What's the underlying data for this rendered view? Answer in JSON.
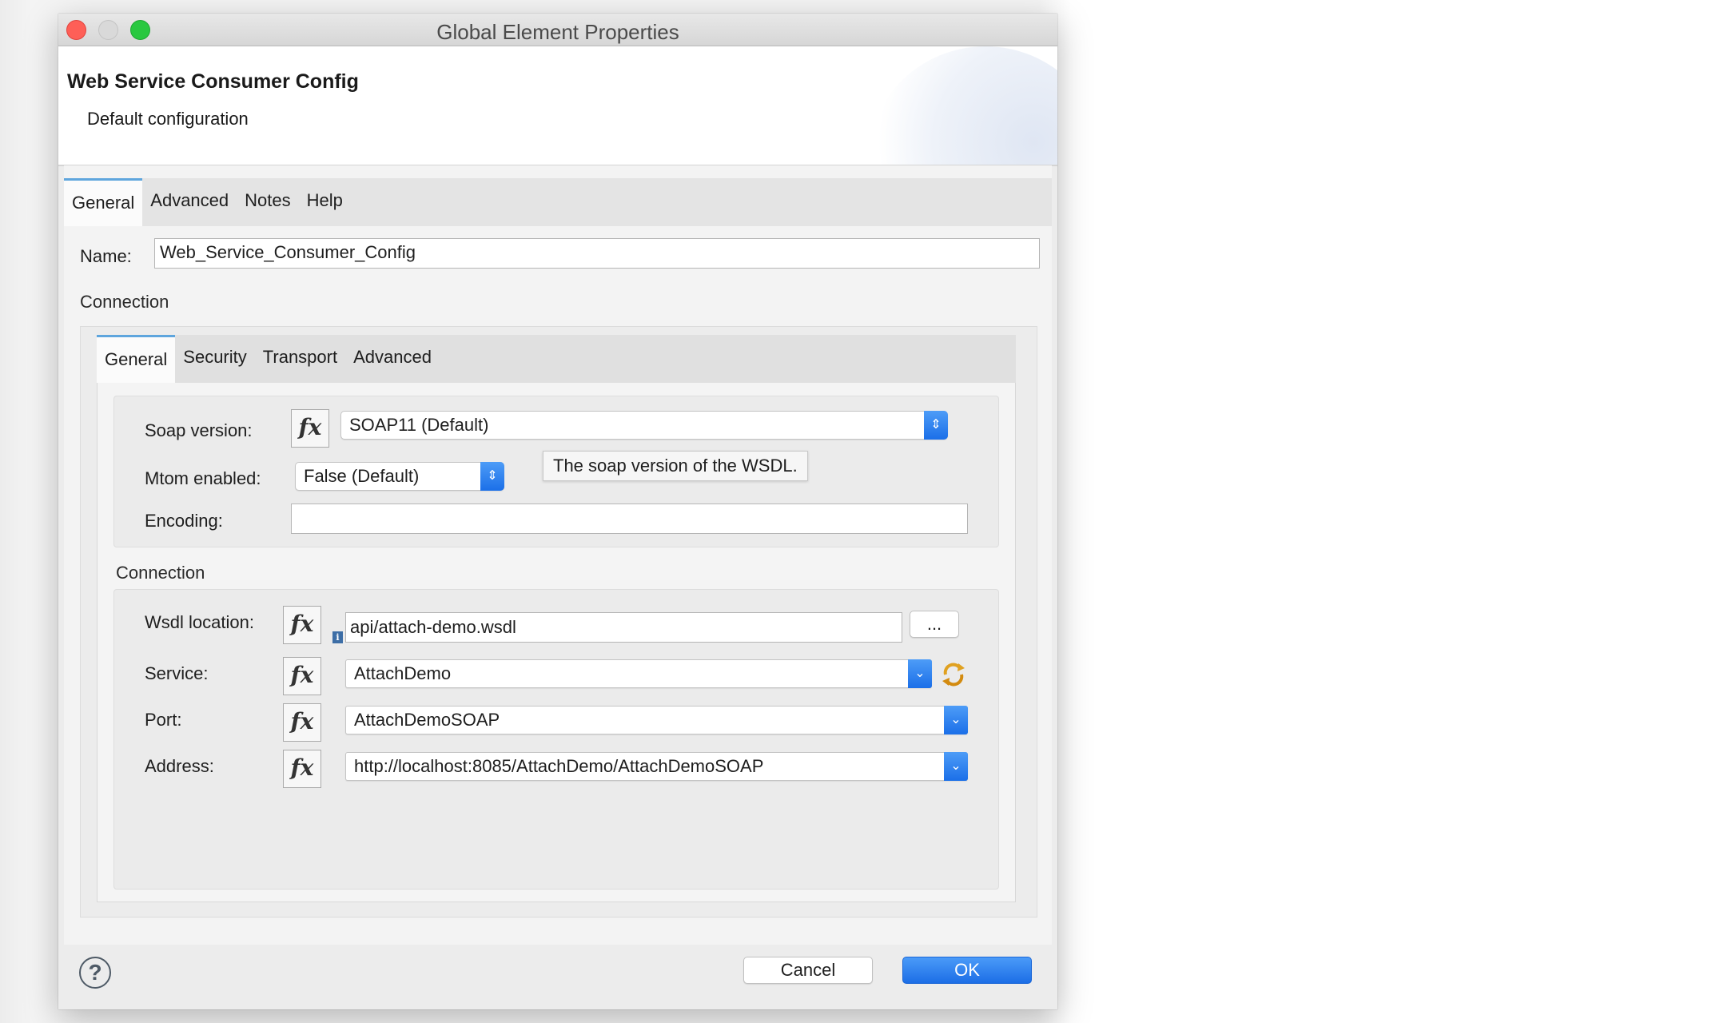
{
  "window": {
    "title": "Global Element Properties"
  },
  "header": {
    "title": "Web Service Consumer Config",
    "subtitle": "Default configuration"
  },
  "tabs": [
    "General",
    "Advanced",
    "Notes",
    "Help"
  ],
  "name_field": {
    "label": "Name:",
    "value": "Web_Service_Consumer_Config"
  },
  "connection_section": {
    "label": "Connection"
  },
  "inner_tabs": [
    "General",
    "Security",
    "Transport",
    "Advanced"
  ],
  "soap_version": {
    "label": "Soap version:",
    "value": "SOAP11 (Default)",
    "fx": "fx"
  },
  "mtom": {
    "label": "Mtom enabled:",
    "value": "False (Default)"
  },
  "tooltip": {
    "text": "The soap version of the WSDL."
  },
  "encoding": {
    "label": "Encoding:",
    "value": ""
  },
  "connection_group": {
    "label": "Connection"
  },
  "wsdl": {
    "label": "Wsdl location:",
    "value": "api/attach-demo.wsdl",
    "browse": "...",
    "fx": "fx"
  },
  "service": {
    "label": "Service:",
    "value": "AttachDemo",
    "fx": "fx"
  },
  "port": {
    "label": "Port:",
    "value": "AttachDemoSOAP",
    "fx": "fx"
  },
  "address": {
    "label": "Address:",
    "value": "http://localhost:8085/AttachDemo/AttachDemoSOAP",
    "fx": "fx"
  },
  "footer": {
    "cancel": "Cancel",
    "ok": "OK",
    "help": "?"
  },
  "colors": {
    "accent": "#1c6ee6",
    "tab_highlight": "#5ea5dd",
    "close": "#fe5f57",
    "maximize": "#29c840"
  }
}
